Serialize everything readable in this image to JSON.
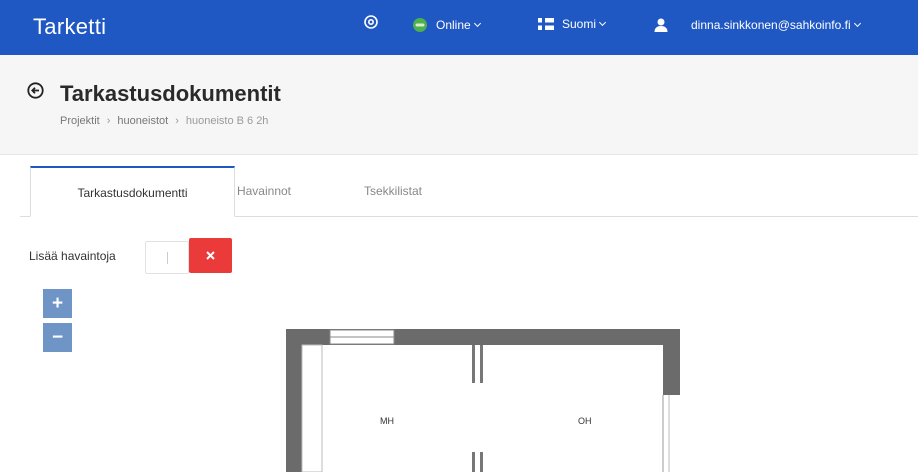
{
  "navbar": {
    "brand": "Tarketti",
    "settings_icon": "gear-icon",
    "status_label": "Online",
    "status_color": "#4caf50",
    "language_label": "Suomi",
    "user_email": "dinna.sinkkonen@sahkoinfo.fi"
  },
  "header": {
    "title": "Tarkastusdokumentit",
    "breadcrumb": [
      "Projektit",
      "huoneistot",
      "huoneisto B 6 2h"
    ]
  },
  "tabs": [
    {
      "label": "Tarkastusdokumentti",
      "active": true
    },
    {
      "label": "Havainnot",
      "active": false
    },
    {
      "label": "Tsekkilistat",
      "active": false
    }
  ],
  "observations": {
    "label": "Lisää havaintoja",
    "input_value": ""
  },
  "zoom": {
    "in_label": "+",
    "out_label": "−"
  },
  "floorplan": {
    "rooms": [
      "MH",
      "OH"
    ]
  },
  "colors": {
    "brand_blue": "#1f57c3",
    "danger": "#ea3a3a",
    "zoom_button": "#6f95c7"
  }
}
